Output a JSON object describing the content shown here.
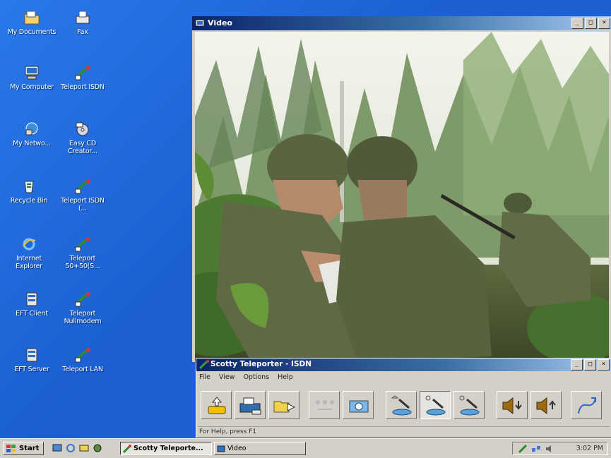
{
  "desktop": {
    "icons": [
      {
        "label": "My Documents",
        "icon": "folder-icon"
      },
      {
        "label": "Fax",
        "icon": "fax-icon"
      },
      {
        "label": "My Computer",
        "icon": "computer-icon"
      },
      {
        "label": "Teleport ISDN",
        "icon": "satellite-shortcut-icon"
      },
      {
        "label": "My Netwo...",
        "icon": "network-icon"
      },
      {
        "label": "Easy CD Creator...",
        "icon": "cd-creator-icon"
      },
      {
        "label": "Recycle Bin",
        "icon": "recycle-bin-icon"
      },
      {
        "label": "Teleport ISDN (...",
        "icon": "satellite-shortcut-icon"
      },
      {
        "label": "Internet Explorer",
        "icon": "internet-explorer-icon"
      },
      {
        "label": "Teleport 50+50(S...",
        "icon": "satellite-shortcut-icon"
      },
      {
        "label": "EFT Client",
        "icon": "server-icon"
      },
      {
        "label": "Teleport Nullmodem",
        "icon": "satellite-shortcut-icon"
      },
      {
        "label": "EFT Server",
        "icon": "server-icon"
      },
      {
        "label": "Teleport LAN",
        "icon": "satellite-shortcut-icon"
      }
    ]
  },
  "video_window": {
    "title": "Video",
    "controls": {
      "minimize": "_",
      "maximize": "□",
      "close": "×"
    },
    "content": "video-feed"
  },
  "teleporter_window": {
    "title": "Scotty Teleporter - ISDN",
    "controls": {
      "minimize": "_",
      "maximize": "□",
      "close": "×"
    },
    "menu": [
      "File",
      "View",
      "Options",
      "Help"
    ],
    "toolbar": [
      {
        "icon": "phone-dial-icon",
        "state": "normal"
      },
      {
        "icon": "fax-machine-icon",
        "state": "normal"
      },
      {
        "icon": "send-file-icon",
        "state": "normal"
      },
      {
        "icon": "network-disabled-icon",
        "state": "disabled"
      },
      {
        "icon": "camera-icon",
        "state": "normal"
      },
      {
        "icon": "video-quality-a-icon",
        "state": "normal"
      },
      {
        "icon": "video-quality-b-icon",
        "state": "pressed"
      },
      {
        "icon": "video-quality-c-icon",
        "state": "normal"
      },
      {
        "icon": "speaker-down-icon",
        "state": "normal"
      },
      {
        "icon": "speaker-up-icon",
        "state": "normal"
      },
      {
        "icon": "hang-up-icon",
        "state": "normal"
      }
    ],
    "status_text": "For Help, press F1"
  },
  "taskbar": {
    "start_label": "Start",
    "quick_launch": [
      "desktop-icon",
      "internet-explorer-icon",
      "outlook-icon",
      "media-icon"
    ],
    "tasks": [
      {
        "label": "Scotty Teleporte...",
        "active": true
      },
      {
        "label": "Video",
        "active": false
      }
    ],
    "clock": "3:02 PM"
  },
  "colors": {
    "desktop_blue": "#1f64d8",
    "titlebar_start": "#0a246a",
    "titlebar_end": "#a6caf0",
    "window_face": "#d4d0c8"
  }
}
